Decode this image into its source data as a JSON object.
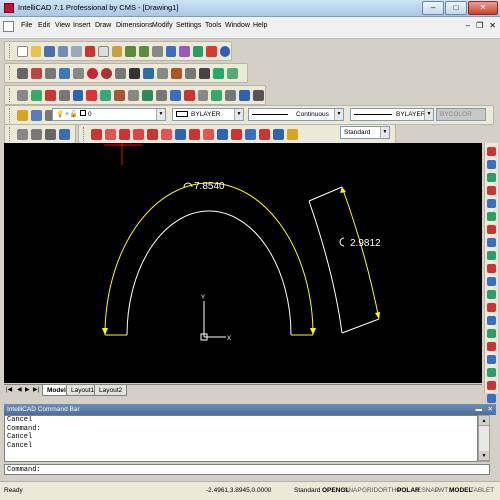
{
  "window": {
    "title": "IntelliCAD 7.1 Professional by CMS - [Drawing1]"
  },
  "menu": [
    "File",
    "Edit",
    "View",
    "Insert",
    "Draw",
    "Dimensions",
    "Modify",
    "Settings",
    "Tools",
    "Window",
    "Help"
  ],
  "properties": {
    "layer": "0",
    "color": "BYLAYER",
    "linetype": "Continuous",
    "lineweight": "BYLAYER",
    "plotstyle": "BYCOLOR",
    "dimstyle": "Standard"
  },
  "drawing": {
    "dim_arc": "7.8540",
    "dim_aligned": "2.9812",
    "ucs_x": "X",
    "ucs_y": "Y"
  },
  "tabs": [
    "Model",
    "Layout1",
    "Layout2"
  ],
  "command_bar": {
    "title": "IntelliCAD Command Bar",
    "history": [
      "Cancel",
      "Command:",
      "Cancel",
      "Cancel"
    ],
    "prompt": "Command:"
  },
  "status": {
    "ready": "Ready",
    "coords": "-2.4961,3.8945,0.0000",
    "style": "Standard",
    "items": [
      "OPENGL",
      "SNAP",
      "GRID",
      "ORTHO",
      "POLAR",
      "ESNAP",
      "LWT",
      "MODEL",
      "TABLET"
    ]
  },
  "colors": {
    "dimension": "#ffff00",
    "geometry": "#ffffff",
    "crosshair": "#ff0000",
    "canvas": "#000000"
  }
}
